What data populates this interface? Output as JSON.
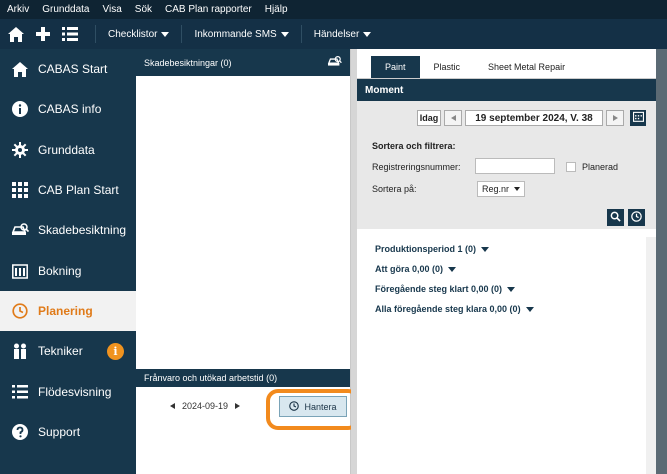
{
  "menubar": [
    "Arkiv",
    "Grunddata",
    "Visa",
    "Sök",
    "CAB Plan rapporter",
    "Hjälp"
  ],
  "toolbar": {
    "dropdowns": [
      "Checklistor",
      "Inkommande SMS",
      "Händelser"
    ]
  },
  "sidebar": {
    "items": [
      {
        "label": "CABAS Start",
        "icon": "home-icon"
      },
      {
        "label": "CABAS info",
        "icon": "info-icon"
      },
      {
        "label": "Grunddata",
        "icon": "gear-icon"
      },
      {
        "label": "CAB Plan Start",
        "icon": "grid-icon"
      },
      {
        "label": "Skadebesiktning",
        "icon": "car-search-icon"
      },
      {
        "label": "Bokning",
        "icon": "calendar-icon"
      },
      {
        "label": "Planering",
        "icon": "clock-icon"
      },
      {
        "label": "Tekniker",
        "icon": "people-icon",
        "badge": "i"
      },
      {
        "label": "Flödesvisning",
        "icon": "list-icon"
      },
      {
        "label": "Support",
        "icon": "question-icon"
      }
    ],
    "active_index": 6
  },
  "left_panel": {
    "title": "Skadebesiktningar (0)",
    "lower_title": "Frånvaro och utökad arbetstid (0)",
    "date": "2024-09-19",
    "hantera_label": "Hantera"
  },
  "right_panel": {
    "tabs": [
      "Paint",
      "Plastic",
      "Sheet Metal Repair"
    ],
    "active_tab": 0,
    "section_title": "Moment",
    "idag_label": "Idag",
    "date_display": "19 september 2024, V. 38",
    "filter_title": "Sortera och filtrera:",
    "reg_label": "Registreringsnummer:",
    "planerad_label": "Planerad",
    "sort_label": "Sortera på:",
    "sort_value": "Reg.nr",
    "groups": [
      "Produktionsperiod 1 (0)",
      "Att göra 0,00 (0)",
      "Föregående steg klart 0,00 (0)",
      "Alla föregående steg klara 0,00 (0)"
    ]
  },
  "colors": {
    "navy": "#17374c",
    "accent_orange": "#f28a1d"
  }
}
